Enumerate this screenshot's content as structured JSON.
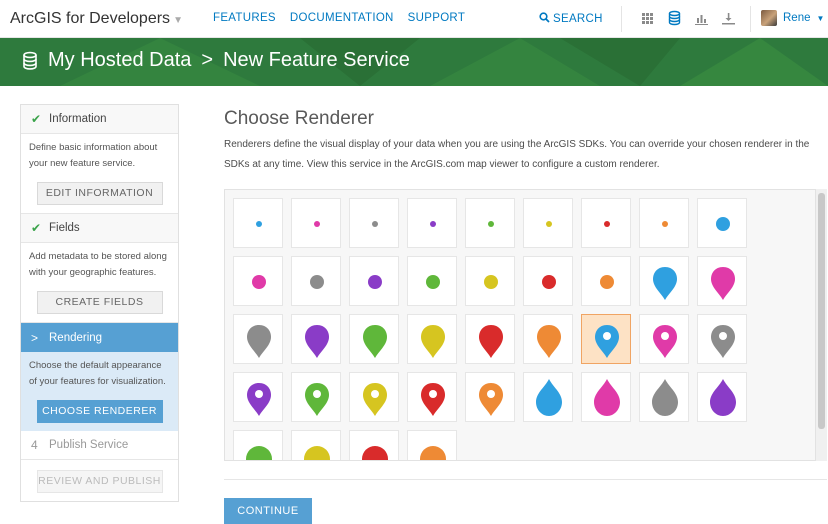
{
  "nav": {
    "brand": "ArcGIS for Developers",
    "links": [
      "FEATURES",
      "DOCUMENTATION",
      "SUPPORT"
    ],
    "search_label": "SEARCH",
    "user_name": "Rene"
  },
  "banner": {
    "title": "My Hosted Data",
    "separator": ">",
    "subtitle": "New Feature Service",
    "color": "#2e7a3d"
  },
  "steps": {
    "information": {
      "label": "Information",
      "desc": "Define basic information about your new feature service.",
      "button": "EDIT INFORMATION"
    },
    "fields": {
      "label": "Fields",
      "desc": "Add metadata to be stored along with your geographic features.",
      "button": "CREATE FIELDS"
    },
    "rendering": {
      "label": "Rendering",
      "desc": "Choose the default appearance of your features for visualization.",
      "button": "CHOOSE RENDERER"
    },
    "publish": {
      "number": "4",
      "label": "Publish Service",
      "button": "REVIEW AND PUBLISH"
    }
  },
  "main": {
    "title": "Choose Renderer",
    "description": "Renderers define the visual display of your data when you are using the ArcGIS SDKs. You can override your chosen renderer in the SDKs at any time. View this service in the ArcGIS.com map viewer to configure a custom renderer.",
    "continue_button": "CONTINUE"
  },
  "renderers": [
    {
      "shape": "small-dot",
      "color": "#2fa0e0"
    },
    {
      "shape": "small-dot",
      "color": "#e03aa8"
    },
    {
      "shape": "small-dot",
      "color": "#8c8c8c"
    },
    {
      "shape": "small-dot",
      "color": "#8a3cc7"
    },
    {
      "shape": "small-dot",
      "color": "#5fb73a"
    },
    {
      "shape": "small-dot",
      "color": "#d6c520"
    },
    {
      "shape": "small-dot",
      "color": "#d92b2b"
    },
    {
      "shape": "small-dot",
      "color": "#ee8a35"
    },
    {
      "shape": "medium-dot",
      "color": "#2fa0e0"
    },
    {
      "shape": "medium-dot",
      "color": "#e03aa8"
    },
    {
      "shape": "medium-dot",
      "color": "#8c8c8c"
    },
    {
      "shape": "medium-dot",
      "color": "#8a3cc7"
    },
    {
      "shape": "medium-dot",
      "color": "#5fb73a"
    },
    {
      "shape": "medium-dot",
      "color": "#d6c520"
    },
    {
      "shape": "medium-dot",
      "color": "#d92b2b"
    },
    {
      "shape": "medium-dot",
      "color": "#ee8a35"
    },
    {
      "shape": "pin",
      "color": "#2fa0e0"
    },
    {
      "shape": "pin",
      "color": "#e03aa8"
    },
    {
      "shape": "pin",
      "color": "#8c8c8c"
    },
    {
      "shape": "pin",
      "color": "#8a3cc7"
    },
    {
      "shape": "pin",
      "color": "#5fb73a"
    },
    {
      "shape": "pin",
      "color": "#d6c520"
    },
    {
      "shape": "pin",
      "color": "#d92b2b"
    },
    {
      "shape": "pin",
      "color": "#ee8a35"
    },
    {
      "shape": "pin-hole",
      "color": "#2fa0e0",
      "selected": true
    },
    {
      "shape": "pin-hole",
      "color": "#e03aa8"
    },
    {
      "shape": "pin-hole",
      "color": "#8c8c8c"
    },
    {
      "shape": "pin-hole",
      "color": "#8a3cc7"
    },
    {
      "shape": "pin-hole",
      "color": "#5fb73a"
    },
    {
      "shape": "pin-hole",
      "color": "#d6c520"
    },
    {
      "shape": "pin-hole",
      "color": "#d92b2b"
    },
    {
      "shape": "pin-hole",
      "color": "#ee8a35"
    },
    {
      "shape": "drop",
      "color": "#2fa0e0"
    },
    {
      "shape": "drop",
      "color": "#e03aa8"
    },
    {
      "shape": "drop",
      "color": "#8c8c8c"
    },
    {
      "shape": "drop",
      "color": "#8a3cc7"
    },
    {
      "shape": "large-dot",
      "color": "#5fb73a"
    },
    {
      "shape": "large-dot",
      "color": "#d6c520"
    },
    {
      "shape": "large-dot",
      "color": "#d92b2b"
    },
    {
      "shape": "large-dot",
      "color": "#ee8a35"
    }
  ]
}
